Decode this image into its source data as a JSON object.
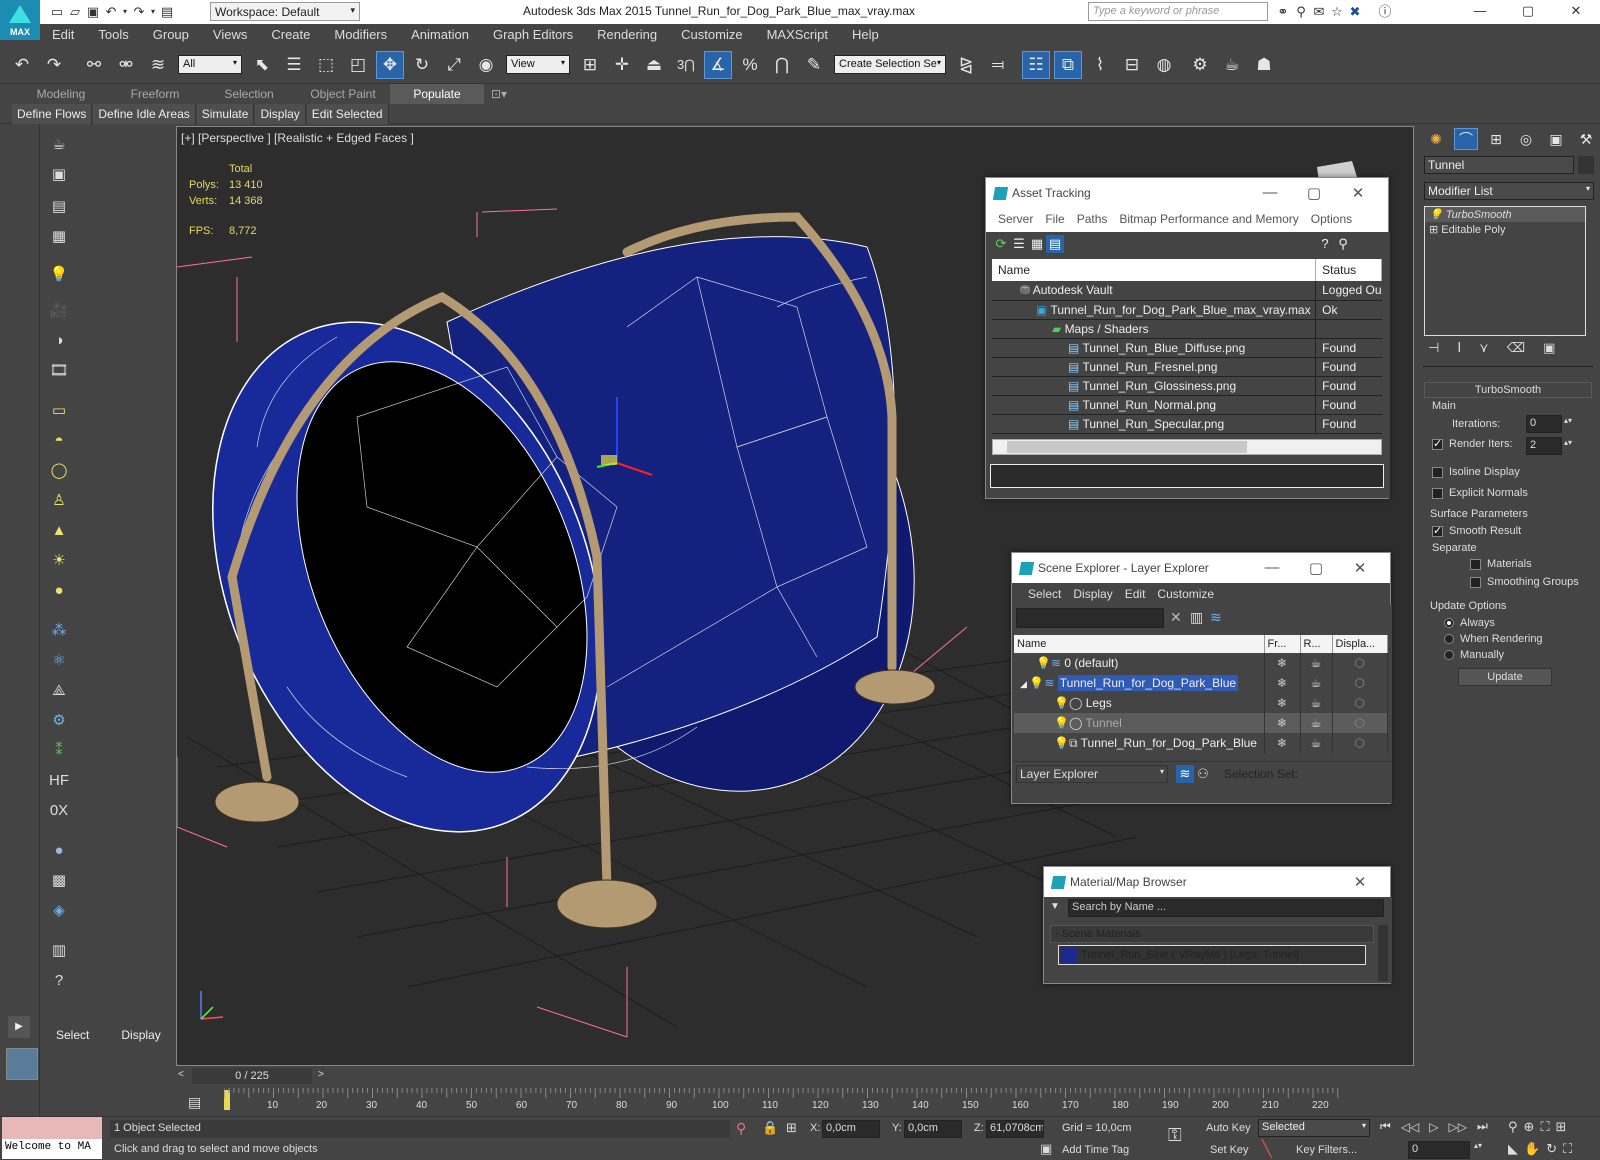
{
  "titlebar": {
    "logo": "MAX",
    "workspace": "Workspace: Default",
    "app_title": "Autodesk 3ds Max  2015     Tunnel_Run_for_Dog_Park_Blue_max_vray.max",
    "search_placeholder": "Type a keyword or phrase"
  },
  "menu": [
    "Edit",
    "Tools",
    "Group",
    "Views",
    "Create",
    "Modifiers",
    "Animation",
    "Graph Editors",
    "Rendering",
    "Customize",
    "MAXScript",
    "Help"
  ],
  "toolbar": {
    "selection_filter": "All",
    "ref_coord": "View",
    "named_selection": "Create Selection Se",
    "snap_label": "3"
  },
  "ribbon_tabs": [
    "Modeling",
    "Freeform",
    "Selection",
    "Object Paint",
    "Populate"
  ],
  "ribbon_active": "Populate",
  "ribbon_items": [
    "Define Flows",
    "Define Idle Areas",
    "Simulate",
    "Display",
    "Edit Selected"
  ],
  "viewport": {
    "label": "[+] [Perspective ] [Realistic + Edged Faces ]",
    "stats_total": "Total",
    "polys_label": "Polys:",
    "polys": "13 410",
    "verts_label": "Verts:",
    "verts": "14 368",
    "fps_label": "FPS:",
    "fps": "8,772"
  },
  "cmd_tabs": [
    "Select",
    "Display"
  ],
  "asset_tracking": {
    "title": "Asset Tracking",
    "menu": [
      "Server",
      "File",
      "Paths",
      "Bitmap Performance and Memory",
      "Options"
    ],
    "columns": [
      "Name",
      "Status"
    ],
    "rows": [
      {
        "name": "Autodesk Vault",
        "status": "Logged Ou",
        "indent": 0
      },
      {
        "name": "Tunnel_Run_for_Dog_Park_Blue_max_vray.max",
        "status": "Ok",
        "indent": 1
      },
      {
        "name": "Maps / Shaders",
        "status": "",
        "indent": 2
      },
      {
        "name": "Tunnel_Run_Blue_Diffuse.png",
        "status": "Found",
        "indent": 3
      },
      {
        "name": "Tunnel_Run_Fresnel.png",
        "status": "Found",
        "indent": 3
      },
      {
        "name": "Tunnel_Run_Glossiness.png",
        "status": "Found",
        "indent": 3
      },
      {
        "name": "Tunnel_Run_Normal.png",
        "status": "Found",
        "indent": 3
      },
      {
        "name": "Tunnel_Run_Specular.png",
        "status": "Found",
        "indent": 3
      }
    ]
  },
  "scene_explorer": {
    "title": "Scene Explorer - Layer Explorer",
    "menu": [
      "Select",
      "Display",
      "Edit",
      "Customize"
    ],
    "columns": [
      "Name",
      "Fr...",
      "R...",
      "Displa..."
    ],
    "rows": [
      {
        "name": "0 (default)",
        "indent": 0,
        "selected": false
      },
      {
        "name": "Tunnel_Run_for_Dog_Park_Blue",
        "indent": 0,
        "selected": true
      },
      {
        "name": "Legs",
        "indent": 1,
        "selected": false
      },
      {
        "name": "Tunnel",
        "indent": 1,
        "selected": false
      },
      {
        "name": "Tunnel_Run_for_Dog_Park_Blue",
        "indent": 1,
        "selected": false
      }
    ],
    "footer_mode": "Layer Explorer",
    "selection_set": "Selection Set:"
  },
  "material_browser": {
    "title": "Material/Map Browser",
    "search_placeholder": "Search by Name ...",
    "group": "- Scene Materials",
    "item": "Tunnel_Run_Blue  ( VRayMtl )  [Legs, Tunnel]"
  },
  "modify_panel": {
    "object_name": "Tunnel",
    "modifier_list": "Modifier List",
    "stack": [
      "TurboSmooth",
      "Editable Poly"
    ],
    "rollout": "TurboSmooth",
    "main": "Main",
    "iterations_label": "Iterations:",
    "iterations": "0",
    "render_iters_label": "Render Iters:",
    "render_iters": "2",
    "isoline": "Isoline Display",
    "explicit": "Explicit Normals",
    "surface": "Surface Parameters",
    "smooth_result": "Smooth Result",
    "separate": "Separate",
    "materials": "Materials",
    "smoothing_groups": "Smoothing Groups",
    "update_options": "Update Options",
    "always": "Always",
    "when_rendering": "When Rendering",
    "manually": "Manually",
    "update_button": "Update"
  },
  "timeline": {
    "frame": "0 / 225",
    "ticks": [
      "10",
      "20",
      "30",
      "40",
      "50",
      "60",
      "70",
      "80",
      "90",
      "100",
      "110",
      "120",
      "130",
      "140",
      "150",
      "160",
      "170",
      "180",
      "190",
      "200",
      "210",
      "220"
    ]
  },
  "status": {
    "selected": "1 Object Selected",
    "prompt": "Click and drag to select and move objects",
    "welcome": "Welcome to MA",
    "x_label": "X:",
    "x": "0,0cm",
    "y_label": "Y:",
    "y": "0,0cm",
    "z_label": "Z:",
    "z": "61,0708cm",
    "grid": "Grid = 10,0cm",
    "add_time_tag": "Add Time Tag",
    "auto_key": "Auto Key",
    "set_key": "Set Key",
    "key_mode": "Selected",
    "key_filters": "Key Filters...",
    "frame_value": "0"
  },
  "colors": {
    "accent": "#2a64a8",
    "tunnel": "#1b2a8c",
    "legs": "#b39a72",
    "selection": "#2f5bb5"
  }
}
